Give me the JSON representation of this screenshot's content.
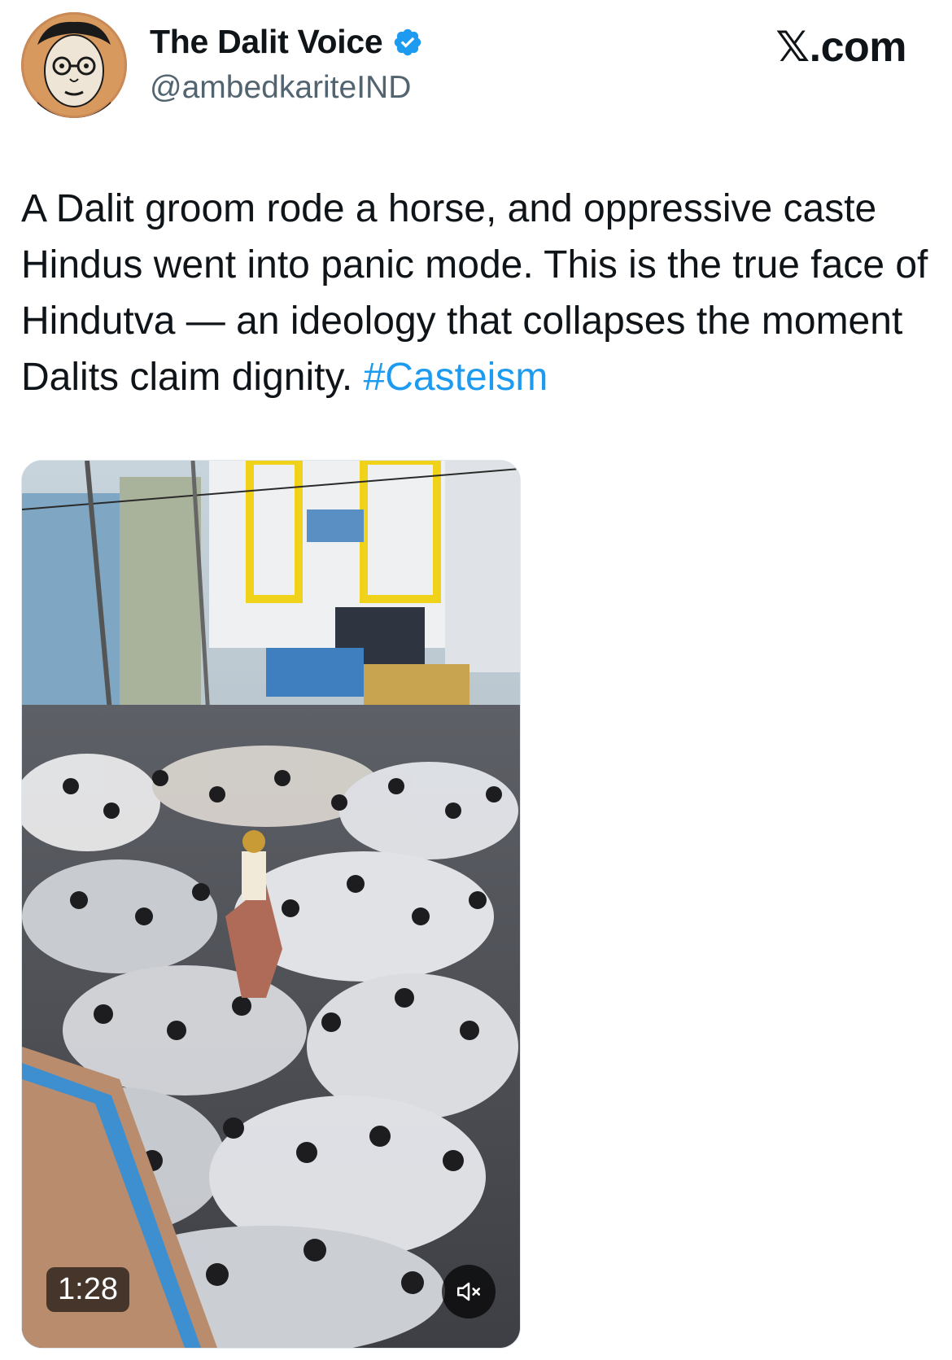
{
  "author": {
    "display_name": "The Dalit Voice",
    "handle": "@ambedkariteIND",
    "verified": true,
    "avatar_icon": "portrait-avatar-icon"
  },
  "site": {
    "label": "𝕏.com"
  },
  "tweet": {
    "text": "A Dalit groom rode a horse, and oppressive caste Hindus went into panic mode. This is the true face of Hindutva — an ideology that collapses the moment Dalits claim dignity. ",
    "hashtag": "#Casteism"
  },
  "media": {
    "type": "video",
    "description_icon": "video-thumbnail-crowd",
    "duration": "1:28",
    "mute_icon": "speaker-muted-icon"
  },
  "colors": {
    "accent": "#1d9bf0",
    "text_primary": "#0f1419",
    "text_secondary": "#536471"
  }
}
